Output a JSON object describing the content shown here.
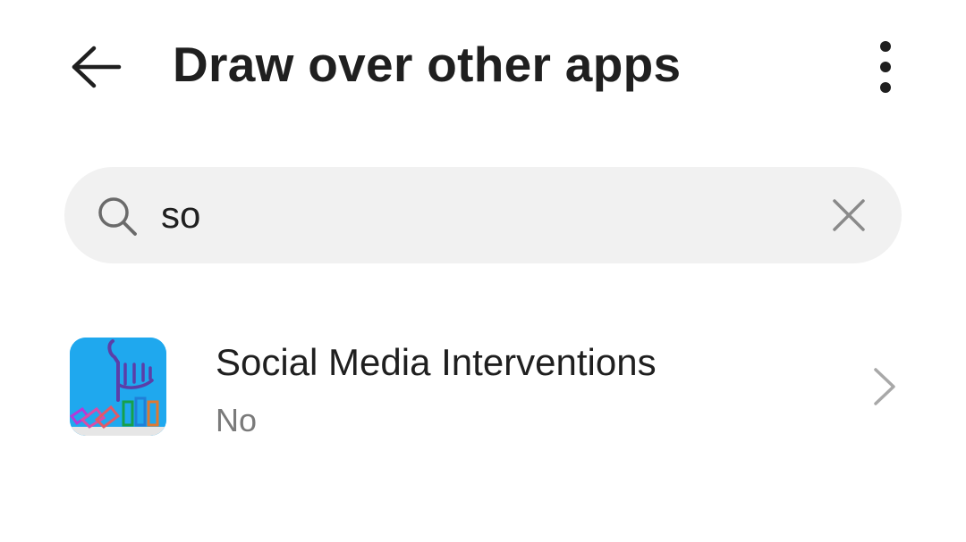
{
  "header": {
    "title": "Draw over other apps",
    "back_icon": "arrow-left-icon",
    "more_icon": "more-vertical-icon"
  },
  "search": {
    "value": "so",
    "placeholder": "",
    "search_icon": "search-icon",
    "clear_icon": "close-icon"
  },
  "apps": [
    {
      "name": "Social Media Interventions",
      "status": "No",
      "icon": "app-icon",
      "icon_bg": "#1fa8ee"
    }
  ],
  "colors": {
    "background": "#ffffff",
    "search_bg": "#f1f1f1",
    "primary_text": "#1f1f1f",
    "secondary_text": "#7a7a7a"
  }
}
